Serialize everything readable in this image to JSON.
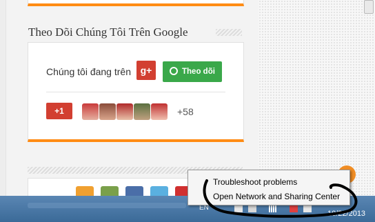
{
  "widget": {
    "heading": "Theo Dõi Chúng Tôi Trên Google",
    "follow_text": "Chúng tôi đang trên",
    "gplus_label": "g+",
    "follow_button_label": "Theo dõi",
    "plus_one_label": "+1",
    "follower_count": "+58"
  },
  "context_menu": {
    "items": [
      {
        "label": "Troubleshoot problems"
      },
      {
        "label": "Open Network and Sharing Center"
      }
    ]
  },
  "taskbar": {
    "language": "EN",
    "clock": "10/22/2013"
  },
  "colors": {
    "accent_orange": "#ff8c14",
    "gplus_red": "#d23f31",
    "follow_green": "#3aa84a"
  }
}
